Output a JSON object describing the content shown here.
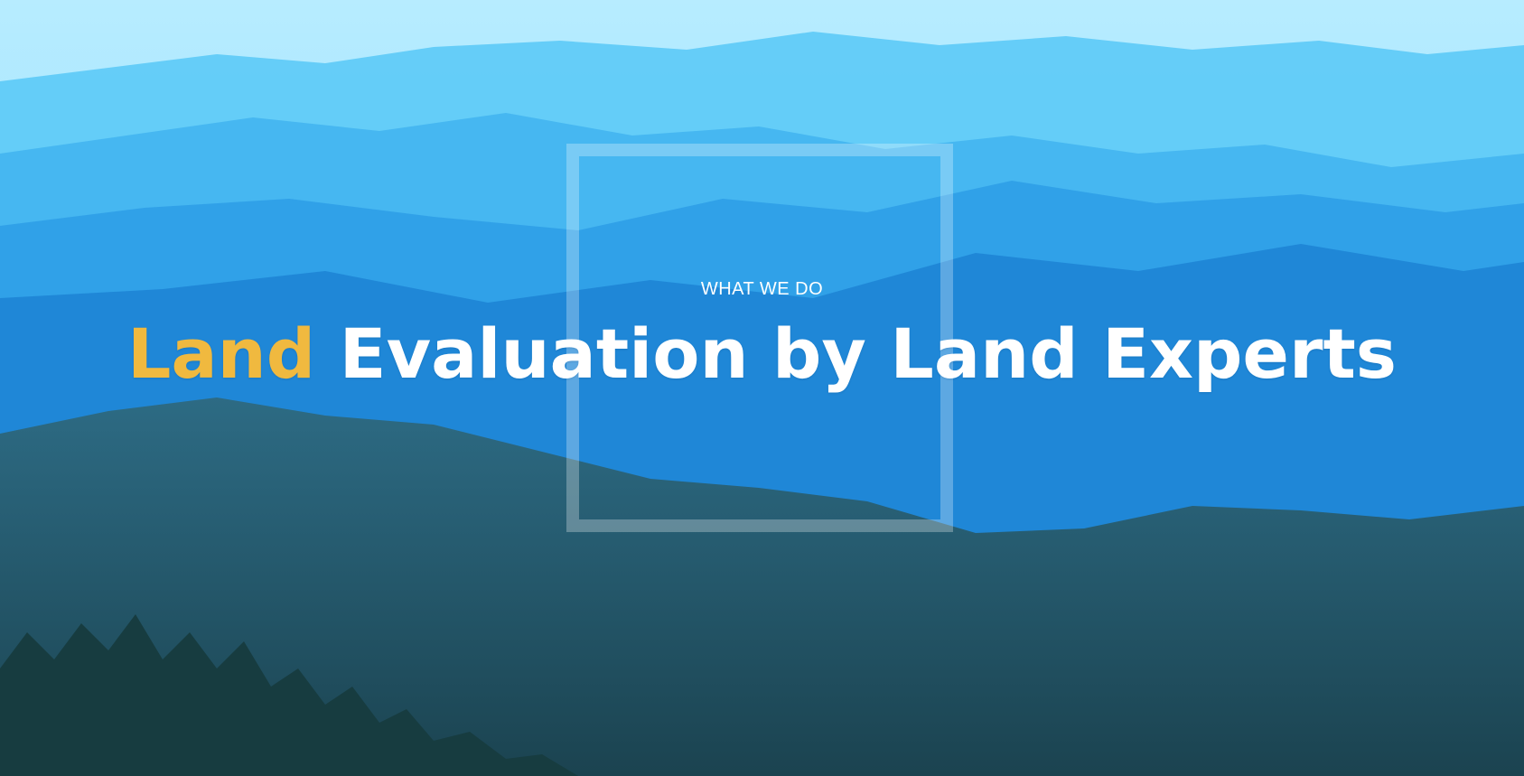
{
  "hero": {
    "eyebrow": "WHAT WE DO",
    "headline_accent": "Land",
    "headline_rest": " Evaluation by Land Experts"
  },
  "colors": {
    "accent": "#f0b93f",
    "text": "#ffffff",
    "sky": "#7fd6fb",
    "mountain_far": "#4fbff4",
    "mountain_mid": "#2d8fe0",
    "forest": "#1f4f63"
  },
  "icons": {
    "background": "mountain-landscape-image",
    "frame": "square-frame-decoration"
  }
}
